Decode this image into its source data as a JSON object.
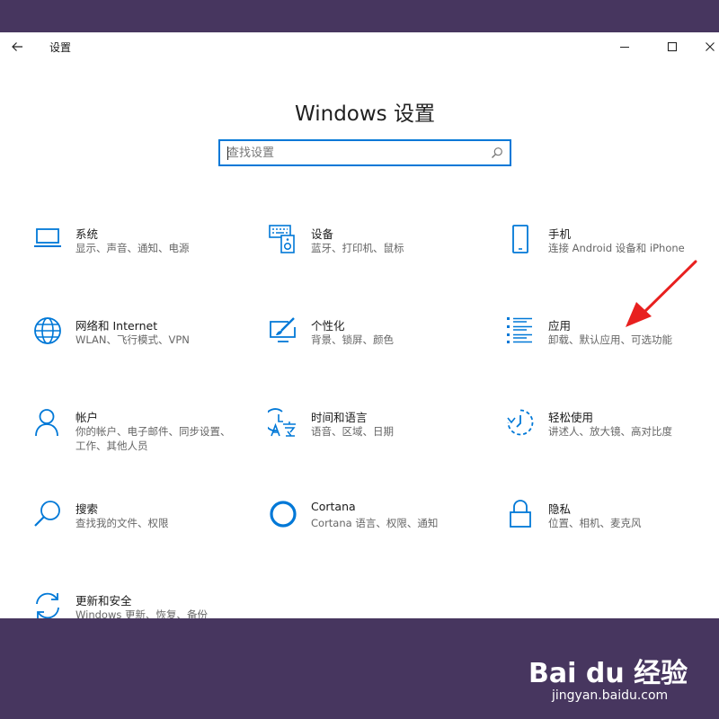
{
  "window": {
    "title": "设置",
    "back_icon": "arrow-left-icon",
    "controls": [
      "minimize-icon",
      "maximize-icon",
      "close-icon"
    ]
  },
  "page": {
    "title": "Windows 设置"
  },
  "search": {
    "placeholder": "查找设置",
    "icon": "search-icon"
  },
  "tiles": [
    {
      "id": "system",
      "name": "系统",
      "desc": "显示、声音、通知、电源",
      "icon": "laptop-icon"
    },
    {
      "id": "devices",
      "name": "设备",
      "desc": "蓝牙、打印机、鼠标",
      "icon": "keyboard-speaker-icon"
    },
    {
      "id": "phone",
      "name": "手机",
      "desc": "连接 Android 设备和 iPhone",
      "icon": "phone-icon"
    },
    {
      "id": "network",
      "name": "网络和 Internet",
      "desc": "WLAN、飞行模式、VPN",
      "icon": "globe-icon"
    },
    {
      "id": "personalization",
      "name": "个性化",
      "desc": "背景、锁屏、颜色",
      "icon": "paint-screen-icon"
    },
    {
      "id": "apps",
      "name": "应用",
      "desc": "卸载、默认应用、可选功能",
      "icon": "apps-list-icon"
    },
    {
      "id": "accounts",
      "name": "帐户",
      "desc": "你的帐户、电子邮件、同步设置、工作、其他人员",
      "icon": "person-icon"
    },
    {
      "id": "time-language",
      "name": "时间和语言",
      "desc": "语音、区域、日期",
      "icon": "time-language-icon"
    },
    {
      "id": "ease-of-access",
      "name": "轻松使用",
      "desc": "讲述人、放大镜、高对比度",
      "icon": "ease-of-access-icon"
    },
    {
      "id": "search",
      "name": "搜索",
      "desc": "查找我的文件、权限",
      "icon": "magnifier-icon"
    },
    {
      "id": "cortana",
      "name": "Cortana",
      "desc": "Cortana 语言、权限、通知",
      "icon": "cortana-circle-icon"
    },
    {
      "id": "privacy",
      "name": "隐私",
      "desc": "位置、相机、麦克风",
      "icon": "lock-icon"
    },
    {
      "id": "update-security",
      "name": "更新和安全",
      "desc": "Windows 更新、恢复、备份",
      "icon": "sync-icon"
    }
  ],
  "colors": {
    "accent": "#0078d7",
    "background": "#47365f",
    "annotation_arrow": "#e8201f"
  },
  "watermark": {
    "logo_text": "Bai du 经验",
    "url": "jingyan.baidu.com"
  }
}
